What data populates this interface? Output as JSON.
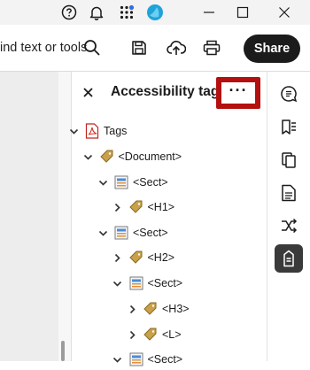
{
  "toolbar": {
    "search_text": "ind text or tools",
    "share_label": "Share"
  },
  "panel": {
    "title": "Accessibility tags",
    "more_label": "···"
  },
  "tree": [
    {
      "label": "Tags",
      "icon": "pdf-icon",
      "expanded": true
    },
    {
      "label": "<Document>",
      "icon": "tag-icon",
      "expanded": true
    },
    {
      "label": "<Sect>",
      "icon": "section-icon",
      "expanded": true
    },
    {
      "label": "<H1>",
      "icon": "tag-icon",
      "expanded": false
    },
    {
      "label": "<Sect>",
      "icon": "section-icon",
      "expanded": true
    },
    {
      "label": "<H2>",
      "icon": "tag-icon",
      "expanded": false
    },
    {
      "label": "<Sect>",
      "icon": "section-icon",
      "expanded": true
    },
    {
      "label": "<H3>",
      "icon": "tag-icon",
      "expanded": false
    },
    {
      "label": "<L>",
      "icon": "tag-icon",
      "expanded": false
    },
    {
      "label": "<Sect>",
      "icon": "section-icon",
      "expanded": true
    }
  ],
  "rail": [
    {
      "icon": "comment-icon",
      "active": false
    },
    {
      "icon": "bookmark-list-icon",
      "active": false
    },
    {
      "icon": "copy-pages-icon",
      "active": false
    },
    {
      "icon": "document-icon",
      "active": false
    },
    {
      "icon": "share-nodes-icon",
      "active": false
    },
    {
      "icon": "accessibility-tags-icon",
      "active": true
    }
  ],
  "colors": {
    "highlight_border": "#b3100f",
    "share_bg": "#1b1b1b",
    "active_rail_bg": "#3a3a3a",
    "tag_icon": "#c9a14a"
  }
}
